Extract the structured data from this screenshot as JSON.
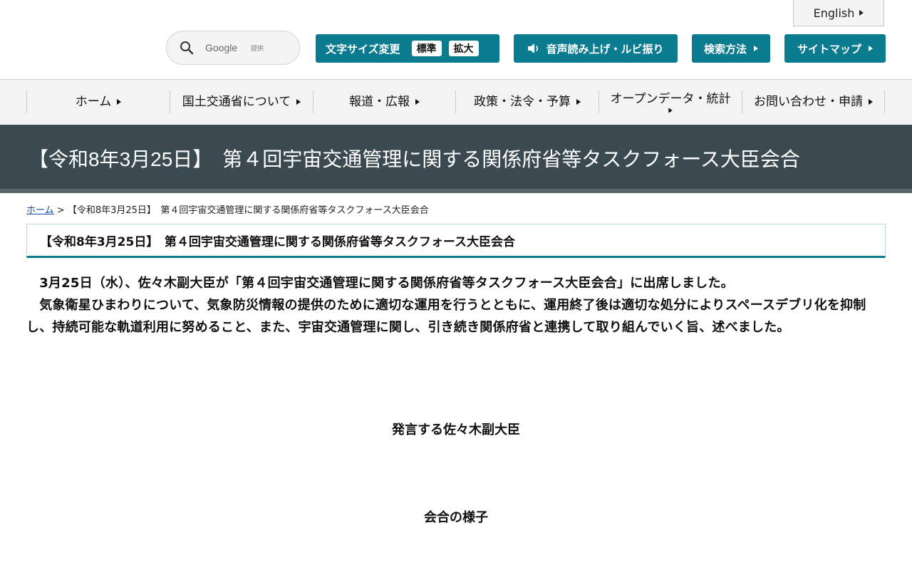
{
  "header": {
    "english_label": "English",
    "search": {
      "placeholder": "Google",
      "provider_suffix": "提供"
    },
    "font_size": {
      "label": "文字サイズ変更",
      "options": [
        "標準",
        "拡大"
      ]
    },
    "voice_label": "音声読み上げ・ルビ振り",
    "search_method_label": "検索方法",
    "sitemap_label": "サイトマップ",
    "accent_color": "#0b7b8f"
  },
  "nav": {
    "items": [
      {
        "label": "ホーム"
      },
      {
        "label": "国土交通省について"
      },
      {
        "label": "報道・広報"
      },
      {
        "label": "政策・法令・予算"
      },
      {
        "label": "オープンデータ・統計"
      },
      {
        "label": "お問い合わせ・申請"
      }
    ]
  },
  "page": {
    "title": "【令和8年3月25日】　第４回宇宙交通管理に関する関係府省等タスクフォース大臣会合",
    "breadcrumb": {
      "home": "ホーム",
      "separator": ">",
      "current": "【令和8年3月25日】　第４回宇宙交通管理に関する関係府省等タスクフォース大臣会合"
    },
    "heading": "【令和8年3月25日】　第４回宇宙交通管理に関する関係府省等タスクフォース大臣会合",
    "paragraphs": [
      "　3月25日（水）、佐々木副大臣が「第４回宇宙交通管理に関する関係府省等タスクフォース大臣会合」に出席しました。",
      "　気象衛星ひまわりについて、気象防災情報の提供のために適切な運用を行うとともに、運用終了後は適切な処分によりスペースデブリ化を抑制し、持続可能な軌道利用に努めること、また、宇宙交通管理に関し、引き続き関係府省と連携して取り組んでいく旨、述べました。"
    ],
    "captions": [
      "発言する佐々木副大臣",
      "会合の様子"
    ]
  }
}
